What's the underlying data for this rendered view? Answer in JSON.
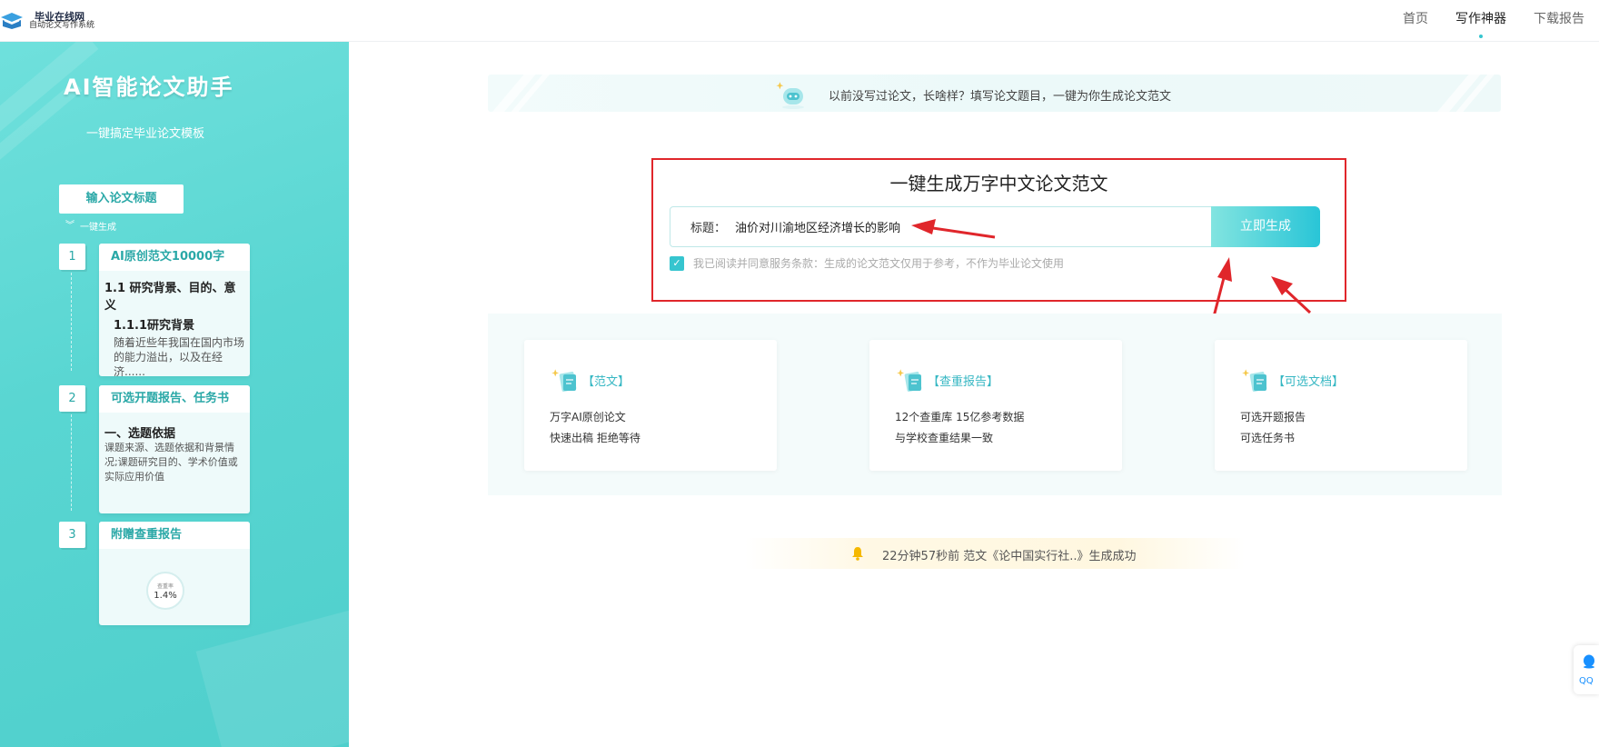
{
  "header": {
    "logo_title": "毕业在线网",
    "logo_sub": "自动论文写作系统",
    "nav": [
      {
        "label": "首页"
      },
      {
        "label": "写作神器"
      },
      {
        "label": "下载报告"
      }
    ],
    "active_nav": "写作神器"
  },
  "sidebar": {
    "title": "AI智能论文助手",
    "subtitle": "一键搞定毕业论文模板",
    "input_step": "输入论文标题",
    "onekey": "一键生成",
    "steps": [
      {
        "num": "1",
        "title": "AI原创范文10000字",
        "h1": "1.1 研究背景、目的、意义",
        "h2": "1.1.1研究背景",
        "text": "随着近些年我国在国内市场的能力溢出，以及在经济......"
      },
      {
        "num": "2",
        "title": "可选开题报告、任务书",
        "h1": "一、选题依据",
        "text": "课题来源、选题依据和背景情况;课题研究目的、学术价值或实际应用价值"
      },
      {
        "num": "3",
        "title": "附赠查重报告",
        "gauge_label": "查重率",
        "gauge_value": "1.4%"
      }
    ]
  },
  "banner": {
    "text": "以前没写过论文，长啥样？填写论文题目，一键为你生成论文范文"
  },
  "generator": {
    "title": "一键生成万字中文论文范文",
    "input_label": "标题：",
    "input_value": "油价对川渝地区经济增长的影响",
    "button": "立即生成",
    "agree_checked": true,
    "agree_text": "我已阅读并同意服务条款：生成的论文范文仅用于参考，不作为毕业论文使用"
  },
  "features": [
    {
      "title": "【范文】",
      "line1": "万字AI原创论文",
      "line2": "快速出稿 拒绝等待"
    },
    {
      "title": "【查重报告】",
      "line1": "12个查重库 15亿参考数据",
      "line2": "与学校查重结果一致"
    },
    {
      "title": "【可选文档】",
      "line1": "可选开题报告",
      "line2": "可选任务书"
    }
  ],
  "notice": {
    "text": "22分钟57秒前 范文《论中国实行社..》生成成功"
  },
  "qq": {
    "label": "QQ"
  },
  "colors": {
    "accent": "#36c5cf",
    "panel": "#59d6d2",
    "annotation": "#e0262b"
  }
}
